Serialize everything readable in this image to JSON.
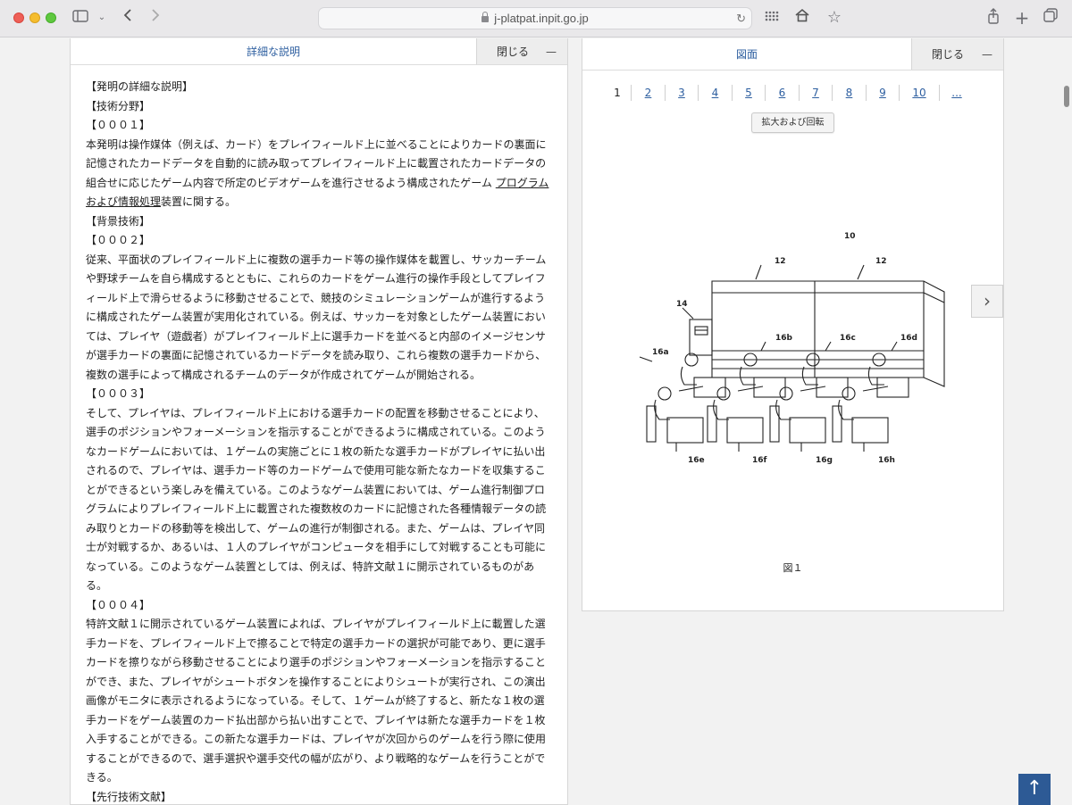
{
  "browser": {
    "url": "j-platpat.inpit.go.jp"
  },
  "left_panel": {
    "title": "詳細な説明",
    "close_label": "閉じる",
    "paragraphs": [
      "【発明の詳細な説明】",
      "【技術分野】",
      "【０００１】",
      "本発明は操作媒体（例えば、カード）をプレイフィールド上に並べることによりカードの裏面に記憶されたカードデータを自動的に読み取ってプレイフィールド上に載置されたカードデータの組合せに応じたゲーム内容で所定のビデオゲームを進行させるよう構成されたゲーム",
      "【背景技術】",
      "【０００２】",
      "従来、平面状のプレイフィールド上に複数の選手カード等の操作媒体を載置し、サッカーチームや野球チームを自ら構成するとともに、これらのカードをゲーム進行の操作手段としてプレイフィールド上で滑らせるように移動させることで、競技のシミュレーションゲームが進行するように構成されたゲーム装置が実用化されている。例えば、サッカーを対象としたゲーム装置においては、プレイヤ（遊戯者）がプレイフィールド上に選手カードを並べると内部のイメージセンサが選手カードの裏面に記憶されているカードデータを読み取り、これら複数の選手カードから、複数の選手によって構成されるチームのデータが作成されてゲームが開始される。",
      "【０００３】",
      "そして、プレイヤは、プレイフィールド上における選手カードの配置を移動させることにより、選手のポジションやフォーメーションを指示することができるように構成されている。このようなカードゲームにおいては、１ゲームの実施ごとに１枚の新たな選手カードがプレイヤに払い出されるので、プレイヤは、選手カード等のカードゲームで使用可能な新たなカードを収集することができるという楽しみを備えている。このようなゲーム装置においては、ゲーム進行制御プログラムによりプレイフィールド上に載置された複数枚のカードに記憶された各種情報データの読み取りとカードの移動等を検出して、ゲームの進行が制御される。また、ゲームは、プレイヤ同士が対戦するか、あるいは、１人のプレイヤがコンピュータを相手にして対戦することも可能になっている。このようなゲーム装置としては、例えば、特許文献１に開示されているものがある。",
      "【０００４】",
      "特許文献１に開示されているゲーム装置によれば、プレイヤがプレイフィールド上に載置した選手カードを、プレイフィールド上で擦ることで特定の選手カードの選択が可能であり、更に選手カードを擦りながら移動させることにより選手のポジションやフォーメーションを指示することができ、また、プレイヤがシュートボタンを操作することによりシュートが実行され、この演出画像がモニタに表示されるようになっている。そして、１ゲームが終了すると、新たな１枚の選手カードをゲーム装置のカード払出部から払い出すことで、プレイヤは新たな選手カードを１枚入手することができる。この新たな選手カードは、プレイヤが次回からのゲームを行う際に使用することができるので、選手選択や選手交代の幅が広がり、より戦略的なゲームを行うことができる。",
      "【先行技術文献】"
    ],
    "link_text": "プログラムおよび情報処理",
    "after_link": "装置に関する。"
  },
  "right_panel": {
    "title": "図面",
    "close_label": "閉じる",
    "pages": [
      "1",
      "2",
      "3",
      "4",
      "5",
      "6",
      "7",
      "8",
      "9",
      "10",
      "..."
    ],
    "current_page": "1",
    "zoom_label": "拡大および回転",
    "figure_caption": "図１",
    "figure_labels": [
      "10",
      "12",
      "12",
      "14",
      "16a",
      "16b",
      "16c",
      "16d",
      "16e",
      "16f",
      "16g",
      "16h"
    ]
  },
  "icons": [
    "sidebar-icon",
    "chevron-down-icon",
    "back-icon",
    "forward-icon",
    "reload-icon",
    "grid-icon",
    "home-icon",
    "star-icon",
    "share-icon",
    "plus-icon",
    "tabs-icon",
    "chevron-right-icon",
    "arrow-up-icon"
  ]
}
